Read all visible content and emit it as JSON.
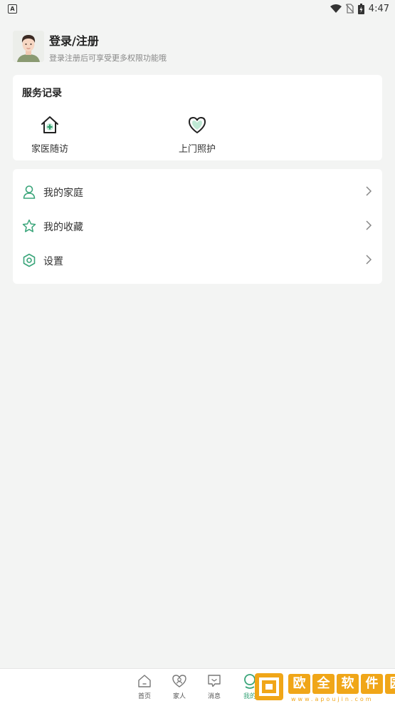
{
  "status_bar": {
    "time": "4:47",
    "left_icon": "A"
  },
  "profile": {
    "title": "登录/注册",
    "subtitle": "登录注册后可享受更多权限功能哦"
  },
  "service_records": {
    "title": "服务记录",
    "items": [
      {
        "label": "家医随访",
        "icon": "house-plus-icon"
      },
      {
        "label": "上门照护",
        "icon": "heart-icon"
      }
    ]
  },
  "menu": {
    "items": [
      {
        "label": "我的家庭",
        "icon": "person-icon"
      },
      {
        "label": "我的收藏",
        "icon": "star-icon"
      },
      {
        "label": "设置",
        "icon": "settings-hexagon-icon"
      }
    ]
  },
  "bottom_nav": {
    "items": [
      {
        "label": "首页",
        "icon": "home-icon"
      },
      {
        "label": "家人",
        "icon": "family-heart-icon"
      },
      {
        "label": "消息",
        "icon": "message-icon"
      },
      {
        "label": "我的",
        "icon": "profile-icon",
        "active": true
      }
    ]
  },
  "watermark": {
    "chars": [
      "欧",
      "全",
      "软",
      "件",
      "园"
    ],
    "url": "www.apoujin.com"
  },
  "colors": {
    "accent": "#3aa57a",
    "background": "#f3f4f3",
    "watermark": "#f0a618"
  }
}
